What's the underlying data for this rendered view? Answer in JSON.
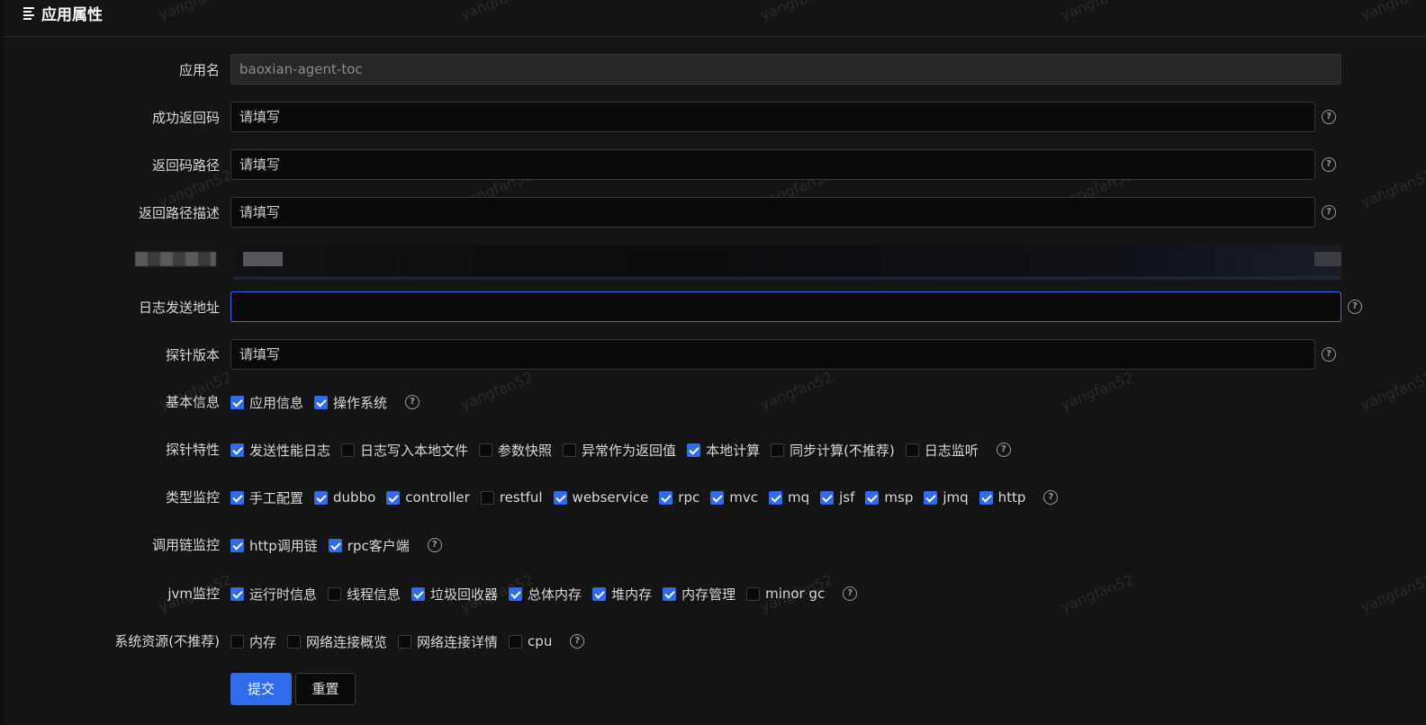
{
  "header": {
    "title": "应用属性"
  },
  "watermark": "yangfan52",
  "fields": [
    {
      "label": "应用名",
      "value": "baoxian-agent-toc",
      "placeholder": "",
      "disabled": true,
      "help": false
    },
    {
      "label": "成功返回码",
      "value": "",
      "placeholder": "请填写",
      "help": true
    },
    {
      "label": "返回码路径",
      "value": "",
      "placeholder": "请填写",
      "help": true
    },
    {
      "label": "返回路径描述",
      "value": "",
      "placeholder": "请填写",
      "help": true
    },
    {
      "label": "日志发送地址",
      "value": "",
      "placeholder": "",
      "focused": true,
      "help": true
    },
    {
      "label": "探针版本",
      "value": "",
      "placeholder": "请填写",
      "help": true
    }
  ],
  "check_groups": [
    {
      "label": "基本信息",
      "items": [
        {
          "label": "应用信息",
          "checked": true
        },
        {
          "label": "操作系统",
          "checked": true
        }
      ]
    },
    {
      "label": "探针特性",
      "items": [
        {
          "label": "发送性能日志",
          "checked": true
        },
        {
          "label": "日志写入本地文件",
          "checked": false
        },
        {
          "label": "参数快照",
          "checked": false
        },
        {
          "label": "异常作为返回值",
          "checked": false
        },
        {
          "label": "本地计算",
          "checked": true
        },
        {
          "label": "同步计算(不推荐)",
          "checked": false
        },
        {
          "label": "日志监听",
          "checked": false
        }
      ]
    },
    {
      "label": "类型监控",
      "items": [
        {
          "label": "手工配置",
          "checked": true
        },
        {
          "label": "dubbo",
          "checked": true
        },
        {
          "label": "controller",
          "checked": true
        },
        {
          "label": "restful",
          "checked": false
        },
        {
          "label": "webservice",
          "checked": true
        },
        {
          "label": "rpc",
          "checked": true
        },
        {
          "label": "mvc",
          "checked": true
        },
        {
          "label": "mq",
          "checked": true
        },
        {
          "label": "jsf",
          "checked": true
        },
        {
          "label": "msp",
          "checked": true
        },
        {
          "label": "jmq",
          "checked": true
        },
        {
          "label": "http",
          "checked": true
        }
      ]
    },
    {
      "label": "调用链监控",
      "items": [
        {
          "label": "http调用链",
          "checked": true
        },
        {
          "label": "rpc客户端",
          "checked": true
        }
      ]
    },
    {
      "label": "jvm监控",
      "items": [
        {
          "label": "运行时信息",
          "checked": true
        },
        {
          "label": "线程信息",
          "checked": false
        },
        {
          "label": "垃圾回收器",
          "checked": true
        },
        {
          "label": "总体内存",
          "checked": true
        },
        {
          "label": "堆内存",
          "checked": true
        },
        {
          "label": "内存管理",
          "checked": true
        },
        {
          "label": "minor gc",
          "checked": false
        }
      ]
    },
    {
      "label": "系统资源(不推荐)",
      "items": [
        {
          "label": "内存",
          "checked": false
        },
        {
          "label": "网络连接概览",
          "checked": false
        },
        {
          "label": "网络连接详情",
          "checked": false
        },
        {
          "label": "cpu",
          "checked": false
        }
      ]
    }
  ],
  "help_glyph": "?",
  "buttons": {
    "submit": "提交",
    "reset": "重置"
  },
  "colors": {
    "primary": "#2f6bea",
    "focus_border": "#3b6cf0",
    "background": "#141415"
  }
}
